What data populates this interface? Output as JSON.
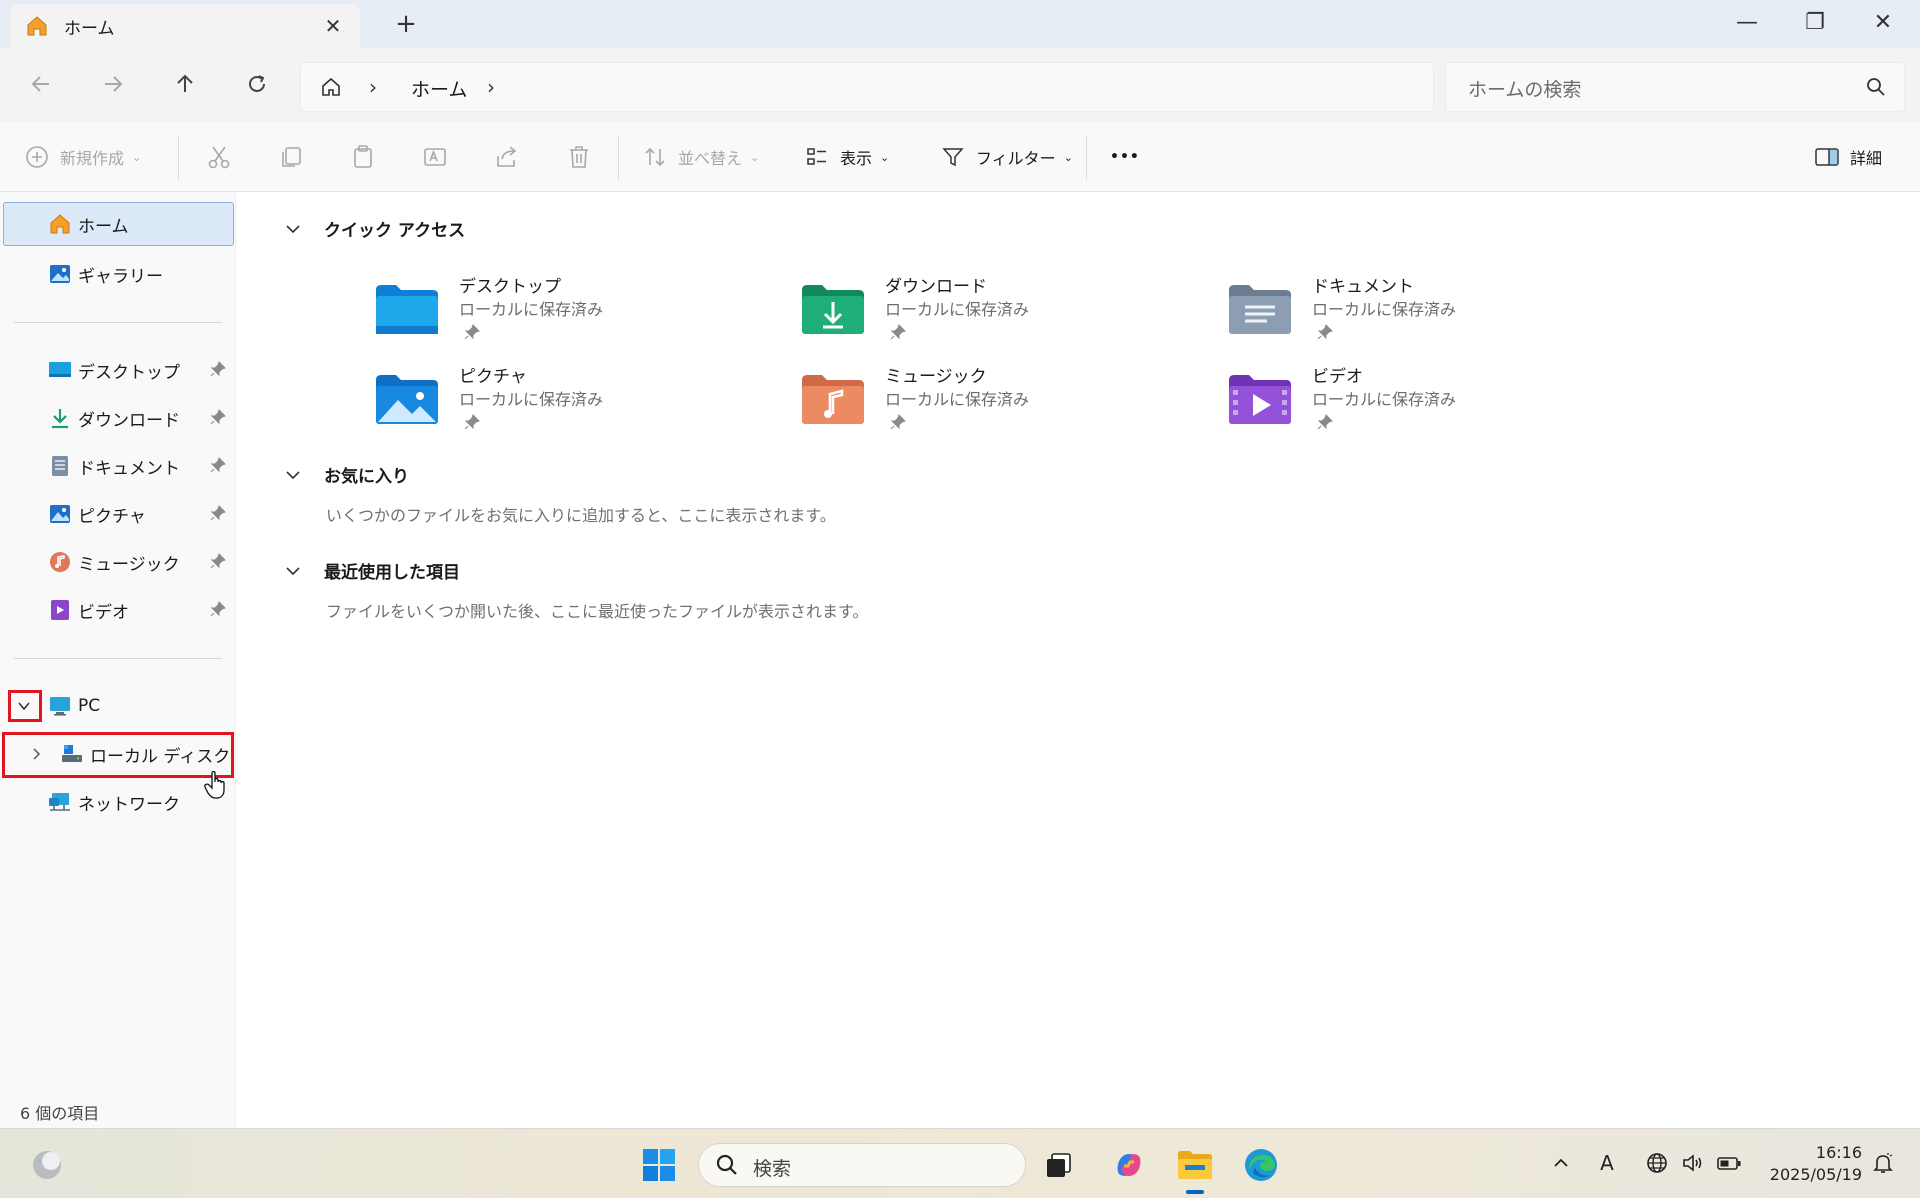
{
  "window": {
    "tab_title": "ホーム",
    "tab_close": "✕",
    "new_tab": "+",
    "minimize": "—",
    "maximize": "❐",
    "close": "✕"
  },
  "address": {
    "separator": "›",
    "crumb": "ホーム",
    "search_placeholder": "ホームの検索"
  },
  "toolbar": {
    "new": "新規作成",
    "sort": "並べ替え",
    "view": "表示",
    "filter": "フィルター",
    "more": "•••",
    "details": "詳細"
  },
  "sidebar": {
    "home": "ホーム",
    "gallery": "ギャラリー",
    "pinned": [
      {
        "label": "デスクトップ",
        "icon": "desktop-icon"
      },
      {
        "label": "ダウンロード",
        "icon": "download-icon"
      },
      {
        "label": "ドキュメント",
        "icon": "document-icon"
      },
      {
        "label": "ピクチャ",
        "icon": "picture-icon"
      },
      {
        "label": "ミュージック",
        "icon": "music-icon"
      },
      {
        "label": "ビデオ",
        "icon": "video-icon"
      }
    ],
    "pc": "PC",
    "local_disk": "ローカル ディスク (C:)",
    "network": "ネットワーク"
  },
  "main": {
    "quick_access": {
      "title": "クイック アクセス",
      "items": [
        {
          "name": "デスクトップ",
          "sub": "ローカルに保存済み",
          "icon": "desktop-folder-icon"
        },
        {
          "name": "ダウンロード",
          "sub": "ローカルに保存済み",
          "icon": "download-folder-icon"
        },
        {
          "name": "ドキュメント",
          "sub": "ローカルに保存済み",
          "icon": "documents-folder-icon"
        },
        {
          "name": "ピクチャ",
          "sub": "ローカルに保存済み",
          "icon": "pictures-folder-icon"
        },
        {
          "name": "ミュージック",
          "sub": "ローカルに保存済み",
          "icon": "music-folder-icon"
        },
        {
          "name": "ビデオ",
          "sub": "ローカルに保存済み",
          "icon": "videos-folder-icon"
        }
      ]
    },
    "favorites": {
      "title": "お気に入り",
      "message": "いくつかのファイルをお気に入りに追加すると、ここに表示されます。"
    },
    "recent": {
      "title": "最近使用した項目",
      "message": "ファイルをいくつか開いた後、ここに最近使ったファイルが表示されます。"
    }
  },
  "status_bar": {
    "item_count": "6 個の項目"
  },
  "taskbar": {
    "search_placeholder": "検索",
    "time": "16:16",
    "date": "2025/05/19",
    "ime": "A"
  },
  "colors": {
    "accent": "#0078d4",
    "highlight_box": "#e0151d",
    "selected_bg": "#dbe9f8"
  }
}
